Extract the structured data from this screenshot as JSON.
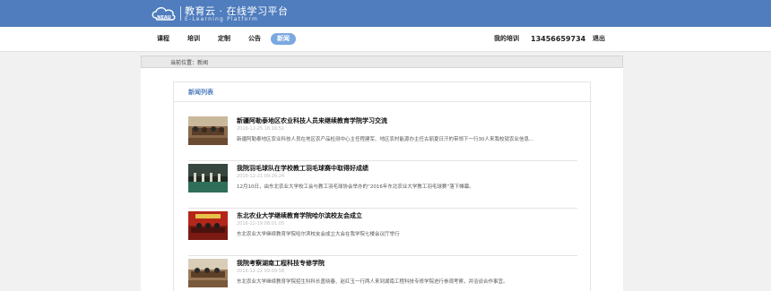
{
  "header": {
    "brand_title": "教育云 · 在线学习平台",
    "brand_subtitle": "E-Learning Platform",
    "logo_text": "NEAU",
    "background_color": "#4f7dbd"
  },
  "nav": {
    "items": [
      {
        "label": "课程"
      },
      {
        "label": "培训"
      },
      {
        "label": "定制"
      },
      {
        "label": "公告"
      },
      {
        "label": "新闻",
        "active": true
      }
    ],
    "my_training": "我的培训",
    "phone": "13456659734",
    "logout": "退出",
    "active_color": "#7ba8e0"
  },
  "breadcrumb": {
    "text": "当前位置：新闻"
  },
  "news_list": {
    "title": "新闻列表",
    "items": [
      {
        "title": "新疆阿勒泰地区农业科技人员来继续教育学院学习交流",
        "date": "2016-12-25 16:16:51",
        "summary": "新疆阿勒泰地区农业科技人员在地区农产品检测中心主任程建军、地区农村能源办主任古丽夏日汗的带领下一行30人来我校就农业信息..."
      },
      {
        "title": "我院羽毛球队在学校教工羽毛球赛中取得好成绩",
        "date": "2016-12-21 09:26:24",
        "summary": "12月10日，由东北农业大学校工会与教工羽毛球协会举办的“2016年东北农业大学教工羽毛球赛”落下帷幕。"
      },
      {
        "title": "东北农业大学继续教育学院哈尔滨校友会成立",
        "date": "2016-12-19 08:01:05",
        "summary": "东北农业大学继续教育学院哈尔滨校友会成立大会在我学院七楼会议厅举行"
      },
      {
        "title": "我院考察湖南工程科技专修学院",
        "date": "2016-12-22 09:09:58",
        "summary": "东北农业大学继续教育学院招生科科长盖晓春、赵红玉一行两人来到湖南工程科技专修学院进行参观考察，并洽谈合作事宜。"
      }
    ]
  }
}
